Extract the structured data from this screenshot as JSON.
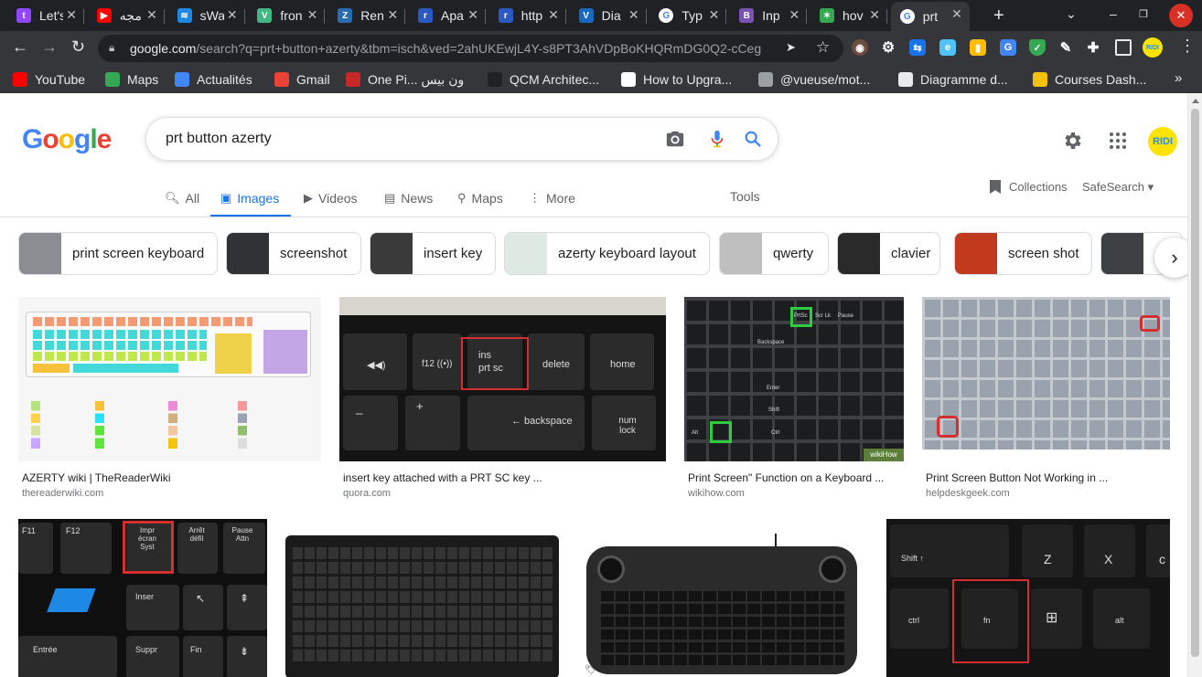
{
  "browser": {
    "tabs": [
      {
        "title": "Let's",
        "favicon": "twitch-icon",
        "color": "#9146ff",
        "glyph": "t"
      },
      {
        "title": "مجه",
        "favicon": "youtube-icon",
        "color": "#ff0000",
        "glyph": "▶"
      },
      {
        "title": "sWa",
        "favicon": "swa-icon",
        "color": "#1e88e5",
        "glyph": "≋"
      },
      {
        "title": "fron",
        "favicon": "vue-icon",
        "color": "#41b883",
        "glyph": "V"
      },
      {
        "title": "Ren",
        "favicon": "render-icon",
        "color": "#2b6cb0",
        "glyph": "Z"
      },
      {
        "title": "Apa",
        "favicon": "r-icon",
        "color": "#2b59c3",
        "glyph": "r"
      },
      {
        "title": "http",
        "favicon": "r-icon",
        "color": "#2b59c3",
        "glyph": "r"
      },
      {
        "title": "Dia",
        "favicon": "vuetify-icon",
        "color": "#1867c0",
        "glyph": "V"
      },
      {
        "title": "Typ",
        "favicon": "google-icon",
        "color": "#ffffff",
        "glyph": "G"
      },
      {
        "title": "Inp",
        "favicon": "bootstrap-icon",
        "color": "#7952b3",
        "glyph": "B"
      },
      {
        "title": "hov",
        "favicon": "spark-icon",
        "color": "#34a853",
        "glyph": "✶"
      },
      {
        "title": "prt",
        "favicon": "google-icon",
        "color": "#ffffff",
        "glyph": "G"
      }
    ],
    "url_host": "google.com",
    "url_path": "/search?q=prt+button+azerty&tbm=isch&ved=2ahUKEwjL4Y-s8PT3AhVDpBoKHQRmDG0Q2-cCeg...",
    "bookmarks": [
      {
        "label": "YouTube",
        "icon": "youtube-icon",
        "color": "#ff0000"
      },
      {
        "label": "Maps",
        "icon": "maps-icon",
        "color": "#34a853"
      },
      {
        "label": "Actualités",
        "icon": "news-icon",
        "color": "#4285f4"
      },
      {
        "label": "Gmail",
        "icon": "gmail-icon",
        "color": "#ea4335"
      },
      {
        "label": "One Pi... ون بيس",
        "icon": "onepiece-icon",
        "color": "#c62828"
      },
      {
        "label": "QCM Architec...",
        "icon": "qcm-icon",
        "color": "#202124"
      },
      {
        "label": "How to Upgra...",
        "icon": "lt-icon",
        "color": "#ffffff"
      },
      {
        "label": "@vueuse/mot...",
        "icon": "vueuse-icon",
        "color": "#9aa0a6"
      },
      {
        "label": "Diagramme d...",
        "icon": "globe-icon",
        "color": "#e8eaed"
      },
      {
        "label": "Courses Dash...",
        "icon": "courses-icon",
        "color": "#f4c20d"
      }
    ]
  },
  "search": {
    "logo": "Google",
    "query": "prt button azerty",
    "tabs": [
      "All",
      "Images",
      "Videos",
      "News",
      "Maps",
      "More"
    ],
    "tools": "Tools",
    "collections": "Collections",
    "safesearch": "SafeSearch",
    "avatar_text": "RIDI"
  },
  "chips": [
    {
      "label": "print screen keyboard",
      "swatch": "#8a8d91"
    },
    {
      "label": "screenshot",
      "swatch": "#2f3336"
    },
    {
      "label": "insert key",
      "swatch": "#3a3a3a"
    },
    {
      "label": "azerty keyboard layout",
      "swatch": "#dfe9e3"
    },
    {
      "label": "qwerty",
      "swatch": "#bfbfbf"
    },
    {
      "label": "clavier",
      "swatch": "#2a2a2a"
    },
    {
      "label": "screen shot",
      "swatch": "#c23a1d"
    },
    {
      "label": "",
      "swatch": "#3c4043"
    }
  ],
  "results": [
    {
      "title": "AZERTY wiki | TheReaderWiki",
      "source": "thereaderwiki.com"
    },
    {
      "title": "insert key attached with a PRT SC key ...",
      "source": "quora.com"
    },
    {
      "title": "Print Screen\" Function on a Keyboard ...",
      "source": "wikihow.com"
    },
    {
      "title": "Print Screen Button Not Working in ...",
      "source": "helpdeskgeek.com"
    },
    {
      "title": "",
      "source": ""
    },
    {
      "title": "",
      "source": ""
    },
    {
      "title": "",
      "source": ""
    },
    {
      "title": "",
      "source": ""
    }
  ],
  "image_text": {
    "quora_keys": [
      "ins",
      "prt sc",
      "delete",
      "home",
      "← backspace",
      "num lock"
    ],
    "wikihow_keys": [
      "PrtSc",
      "Scr Lk",
      "Pause",
      "Backspace",
      "Enter",
      "Shift",
      "Alt",
      "Ctrl"
    ],
    "azerty_keys": [
      "Impr écran Syst",
      "Arrêt défil",
      "Pause Attn",
      "Inser",
      "Suppr",
      "Fin",
      "Entrée",
      "F11",
      "F12"
    ],
    "laptop_keys": [
      "Shift ↑",
      "Z",
      "X",
      "ctrl",
      "fn",
      "alt"
    ],
    "watermark": "wikiHow"
  }
}
